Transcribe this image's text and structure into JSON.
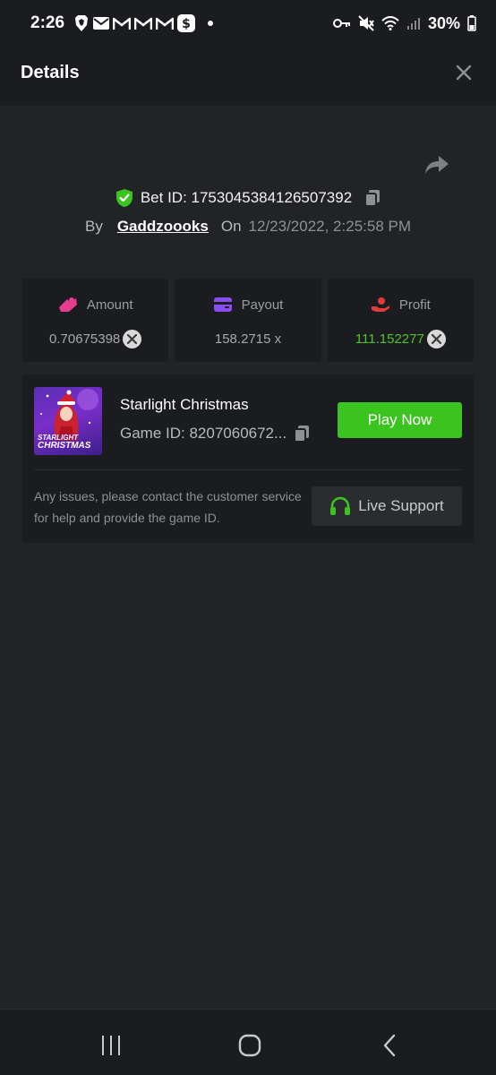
{
  "status_bar": {
    "time": "2:26",
    "battery": "30%",
    "left_icons": [
      "brave-icon",
      "mail-icon",
      "gmail-icon",
      "gmail-icon",
      "gmail-icon",
      "cash-app-icon",
      "dot-icon"
    ],
    "right_icons": [
      "key-icon",
      "mute-icon",
      "wifi-icon",
      "signal-icon",
      "battery-icon"
    ]
  },
  "header": {
    "title": "Details"
  },
  "bet": {
    "id_text": "Bet ID: 1753045384126507392",
    "by_label": "By",
    "username": "Gaddzoooks",
    "on_label": "On",
    "date": "12/23/2022, 2:25:58 PM"
  },
  "stats": [
    {
      "label": "Amount",
      "value": "0.70675398",
      "icon": "amount-icon",
      "icon_color": "#e83d8f"
    },
    {
      "label": "Payout",
      "value": "158.2715 x",
      "icon": "card-icon",
      "icon_color": "#8a4df2"
    },
    {
      "label": "Profit",
      "value": "111.152277",
      "icon": "profit-hand-icon",
      "icon_color": "#e23a3a"
    }
  ],
  "game": {
    "name": "Starlight Christmas",
    "id_text": "Game ID: 8207060672...",
    "thumb_line1": "STARLIGHT",
    "thumb_line2": "CHRISTMAS",
    "play_label": "Play Now",
    "support_text": "Any issues, please contact the customer service for help and provide the game ID.",
    "live_support_label": "Live Support"
  },
  "colors": {
    "accent_green": "#3bc31f",
    "profit_green": "#4fc42a",
    "background": "#222326",
    "panel": "#1b1c1f"
  }
}
